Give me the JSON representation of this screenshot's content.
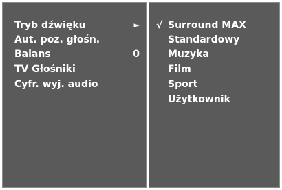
{
  "menu": {
    "items": [
      {
        "label": "Tryb dźwięku",
        "value": "►"
      },
      {
        "label": "Aut. poz. głośn.",
        "value": ""
      },
      {
        "label": "Balans",
        "value": "0"
      },
      {
        "label": "TV Głośniki",
        "value": ""
      },
      {
        "label": "Cyfr. wyj. audio",
        "value": ""
      }
    ]
  },
  "submenu": {
    "check_mark": "√",
    "options": [
      {
        "label": "Surround MAX"
      },
      {
        "label": "Standardowy"
      },
      {
        "label": "Muzyka"
      },
      {
        "label": "Film"
      },
      {
        "label": "Sport"
      },
      {
        "label": "Użytkownik"
      }
    ]
  }
}
